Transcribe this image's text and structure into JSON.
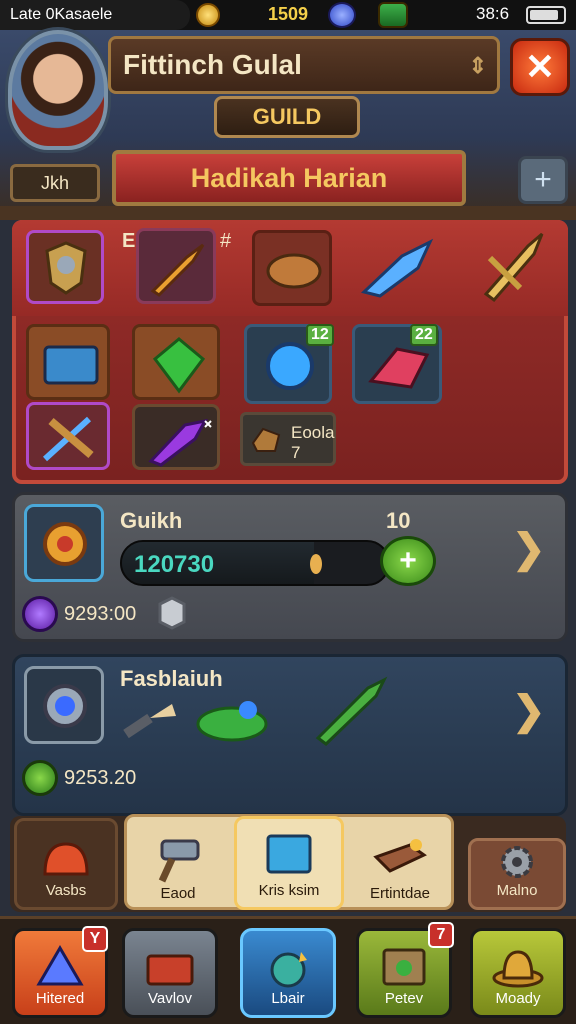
{
  "status": {
    "carrier": "Late 0Kasaele",
    "currency": "1509",
    "time": "38:6"
  },
  "header": {
    "guild_name": "Fittinch Gulal",
    "guild_tab": "GUILD",
    "side_tab": "Jkh",
    "banner": "Hadikah Harian",
    "close_glyph": "✕",
    "plus_glyph": "+",
    "arrow_glyph": "⇕"
  },
  "items": {
    "ent_label": "ENT",
    "hash_label": "#",
    "badge_1": "12",
    "badge_2": "22",
    "small_label_line1": "Eoola",
    "small_label_line2": "7"
  },
  "guild_panel": {
    "title": "Guikh",
    "progress_text": "120730",
    "progress": 0.72,
    "pin": "10",
    "stat": "9293:00",
    "chevron": "❯",
    "plus": "+"
  },
  "event_panel": {
    "title": "Fasblaiuh",
    "stat": "9253.20",
    "chevron": "❯"
  },
  "toolbar": [
    {
      "label": "Vasbs",
      "icon": "helmet-icon"
    },
    {
      "label": "Eaod",
      "icon": "hammer-icon"
    },
    {
      "label": "Kris ksim",
      "icon": "scroll-icon"
    },
    {
      "label": "Ertintdae",
      "icon": "anvil-icon"
    },
    {
      "label": "Malno",
      "icon": "gear-icon"
    }
  ],
  "nav": [
    {
      "label": "Hitered",
      "icon": "crystal-icon",
      "badge": "Y"
    },
    {
      "label": "Vavlov",
      "icon": "chest-icon"
    },
    {
      "label": "Lbair",
      "icon": "potion-icon"
    },
    {
      "label": "Petev",
      "icon": "map-icon",
      "badge": "7"
    },
    {
      "label": "Moady",
      "icon": "hat-icon"
    }
  ],
  "colors": {
    "accent": "#f5c860",
    "panel_red": "#9a2e2a",
    "panel_gray": "#5a5d62",
    "panel_blue": "#31455e",
    "progress_text": "#4ad8c0"
  }
}
